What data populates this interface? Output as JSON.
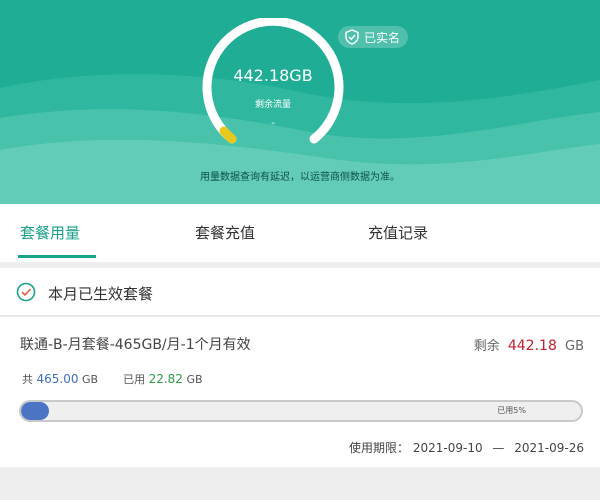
{
  "header": {
    "verified_badge": "已实名",
    "remaining_amount": "442.18GB",
    "remaining_label": "剩余流量",
    "ring_dash": "-",
    "usage_fraction": 0.05,
    "notice": "用量数据查询有延迟，以运营商侧数据为准。",
    "colors": {
      "background": "#1fae95",
      "ring": "#ffffff",
      "ring_accent": "#e8c81d"
    }
  },
  "tabs": [
    {
      "label": "套餐用量",
      "active": true
    },
    {
      "label": "套餐充值",
      "active": false
    },
    {
      "label": "充值记录",
      "active": false
    }
  ],
  "section": {
    "title": "本月已生效套餐"
  },
  "package": {
    "name": "联通-B-月套餐-465GB/月-1个月有效",
    "remaining_label": "剩余",
    "remaining_value": "442.18",
    "remaining_unit": "GB",
    "total_label": "共",
    "total_value": "465.00",
    "total_unit": "GB",
    "used_label": "已用",
    "used_value": "22.82",
    "used_unit": "GB",
    "used_percent_text": "已用5%",
    "used_fraction": 0.05,
    "period_label": "使用期限：",
    "period_start": "2021-09-10",
    "period_sep": "—",
    "period_end": "2021-09-26"
  }
}
